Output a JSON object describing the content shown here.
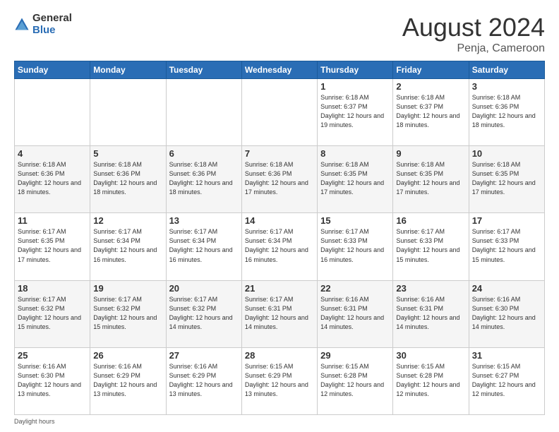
{
  "logo": {
    "general": "General",
    "blue": "Blue"
  },
  "header": {
    "month": "August 2024",
    "location": "Penja, Cameroon"
  },
  "days_of_week": [
    "Sunday",
    "Monday",
    "Tuesday",
    "Wednesday",
    "Thursday",
    "Friday",
    "Saturday"
  ],
  "weeks": [
    [
      {
        "day": "",
        "info": ""
      },
      {
        "day": "",
        "info": ""
      },
      {
        "day": "",
        "info": ""
      },
      {
        "day": "",
        "info": ""
      },
      {
        "day": "1",
        "info": "Sunrise: 6:18 AM\nSunset: 6:37 PM\nDaylight: 12 hours\nand 19 minutes."
      },
      {
        "day": "2",
        "info": "Sunrise: 6:18 AM\nSunset: 6:37 PM\nDaylight: 12 hours\nand 18 minutes."
      },
      {
        "day": "3",
        "info": "Sunrise: 6:18 AM\nSunset: 6:36 PM\nDaylight: 12 hours\nand 18 minutes."
      }
    ],
    [
      {
        "day": "4",
        "info": "Sunrise: 6:18 AM\nSunset: 6:36 PM\nDaylight: 12 hours\nand 18 minutes."
      },
      {
        "day": "5",
        "info": "Sunrise: 6:18 AM\nSunset: 6:36 PM\nDaylight: 12 hours\nand 18 minutes."
      },
      {
        "day": "6",
        "info": "Sunrise: 6:18 AM\nSunset: 6:36 PM\nDaylight: 12 hours\nand 18 minutes."
      },
      {
        "day": "7",
        "info": "Sunrise: 6:18 AM\nSunset: 6:36 PM\nDaylight: 12 hours\nand 17 minutes."
      },
      {
        "day": "8",
        "info": "Sunrise: 6:18 AM\nSunset: 6:35 PM\nDaylight: 12 hours\nand 17 minutes."
      },
      {
        "day": "9",
        "info": "Sunrise: 6:18 AM\nSunset: 6:35 PM\nDaylight: 12 hours\nand 17 minutes."
      },
      {
        "day": "10",
        "info": "Sunrise: 6:18 AM\nSunset: 6:35 PM\nDaylight: 12 hours\nand 17 minutes."
      }
    ],
    [
      {
        "day": "11",
        "info": "Sunrise: 6:17 AM\nSunset: 6:35 PM\nDaylight: 12 hours\nand 17 minutes."
      },
      {
        "day": "12",
        "info": "Sunrise: 6:17 AM\nSunset: 6:34 PM\nDaylight: 12 hours\nand 16 minutes."
      },
      {
        "day": "13",
        "info": "Sunrise: 6:17 AM\nSunset: 6:34 PM\nDaylight: 12 hours\nand 16 minutes."
      },
      {
        "day": "14",
        "info": "Sunrise: 6:17 AM\nSunset: 6:34 PM\nDaylight: 12 hours\nand 16 minutes."
      },
      {
        "day": "15",
        "info": "Sunrise: 6:17 AM\nSunset: 6:33 PM\nDaylight: 12 hours\nand 16 minutes."
      },
      {
        "day": "16",
        "info": "Sunrise: 6:17 AM\nSunset: 6:33 PM\nDaylight: 12 hours\nand 15 minutes."
      },
      {
        "day": "17",
        "info": "Sunrise: 6:17 AM\nSunset: 6:33 PM\nDaylight: 12 hours\nand 15 minutes."
      }
    ],
    [
      {
        "day": "18",
        "info": "Sunrise: 6:17 AM\nSunset: 6:32 PM\nDaylight: 12 hours\nand 15 minutes."
      },
      {
        "day": "19",
        "info": "Sunrise: 6:17 AM\nSunset: 6:32 PM\nDaylight: 12 hours\nand 15 minutes."
      },
      {
        "day": "20",
        "info": "Sunrise: 6:17 AM\nSunset: 6:32 PM\nDaylight: 12 hours\nand 14 minutes."
      },
      {
        "day": "21",
        "info": "Sunrise: 6:17 AM\nSunset: 6:31 PM\nDaylight: 12 hours\nand 14 minutes."
      },
      {
        "day": "22",
        "info": "Sunrise: 6:16 AM\nSunset: 6:31 PM\nDaylight: 12 hours\nand 14 minutes."
      },
      {
        "day": "23",
        "info": "Sunrise: 6:16 AM\nSunset: 6:31 PM\nDaylight: 12 hours\nand 14 minutes."
      },
      {
        "day": "24",
        "info": "Sunrise: 6:16 AM\nSunset: 6:30 PM\nDaylight: 12 hours\nand 14 minutes."
      }
    ],
    [
      {
        "day": "25",
        "info": "Sunrise: 6:16 AM\nSunset: 6:30 PM\nDaylight: 12 hours\nand 13 minutes."
      },
      {
        "day": "26",
        "info": "Sunrise: 6:16 AM\nSunset: 6:29 PM\nDaylight: 12 hours\nand 13 minutes."
      },
      {
        "day": "27",
        "info": "Sunrise: 6:16 AM\nSunset: 6:29 PM\nDaylight: 12 hours\nand 13 minutes."
      },
      {
        "day": "28",
        "info": "Sunrise: 6:15 AM\nSunset: 6:29 PM\nDaylight: 12 hours\nand 13 minutes."
      },
      {
        "day": "29",
        "info": "Sunrise: 6:15 AM\nSunset: 6:28 PM\nDaylight: 12 hours\nand 12 minutes."
      },
      {
        "day": "30",
        "info": "Sunrise: 6:15 AM\nSunset: 6:28 PM\nDaylight: 12 hours\nand 12 minutes."
      },
      {
        "day": "31",
        "info": "Sunrise: 6:15 AM\nSunset: 6:27 PM\nDaylight: 12 hours\nand 12 minutes."
      }
    ]
  ],
  "footer": {
    "daylight_label": "Daylight hours"
  }
}
